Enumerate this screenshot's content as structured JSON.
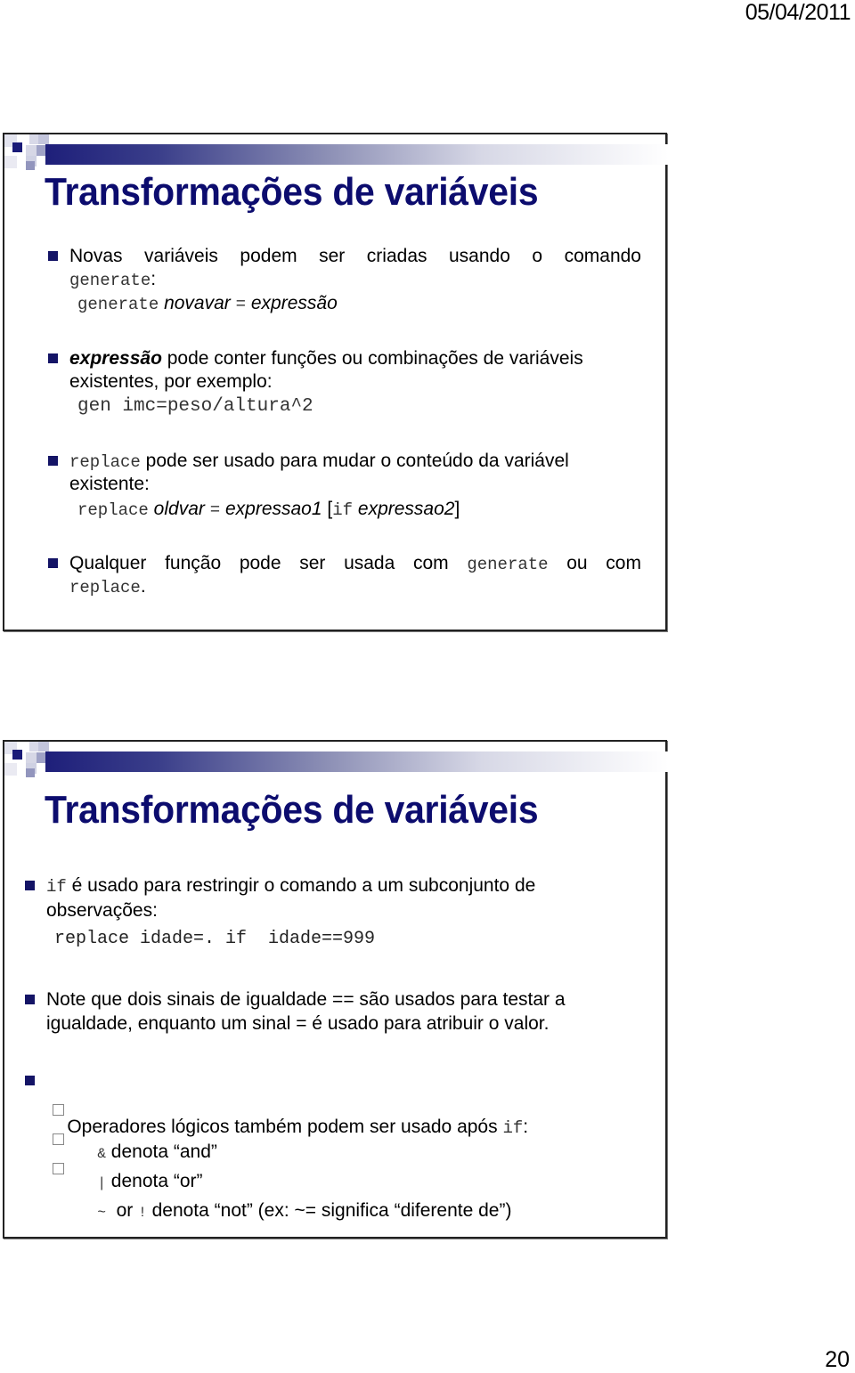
{
  "header": {
    "date": "05/04/2011"
  },
  "footer": {
    "page_number": "20"
  },
  "colors": {
    "title": "#0c0c6e",
    "bullet": "#141466",
    "code": "#333333"
  },
  "slides": [
    {
      "title": "Transformações de variáveis",
      "bullets": [
        {
          "icon": "square-bullet-icon",
          "text_line1": "Novas variáveis podem ser criadas usando o comando",
          "code_line2": "generate",
          "text_line2_suffix": ":",
          "code_example": {
            "cmd": "generate",
            "arg1": "novavar",
            "eq": "=",
            "arg2": "expressão"
          }
        },
        {
          "icon": "square-bullet-icon",
          "bold_italic": "expressão",
          "text_line1": " pode conter funções ou combinações de variáveis",
          "text_line2": "existentes, por exemplo:",
          "code_example": "gen imc=peso/altura^2"
        },
        {
          "icon": "square-bullet-icon",
          "code_prefix": "replace",
          "text_line1": " pode ser usado para mudar o conteúdo da variável",
          "text_line2": "existente:",
          "code_example": {
            "cmd": "replace",
            "arg1": "oldvar",
            "eq": "=",
            "arg2": "expressao1",
            "bracket_open": "[",
            "kw": "if",
            "arg3": "expressao2",
            "bracket_close": "]"
          }
        },
        {
          "icon": "square-bullet-icon",
          "text_line1": "Qualquer função pode ser usada com",
          "code_mid": "generate",
          "text_line1_suffix": "ou com",
          "code_line2": "replace",
          "text_line2_suffix": "."
        }
      ]
    },
    {
      "title": "Transformações de variáveis",
      "bullets": [
        {
          "icon": "square-bullet-icon",
          "code_prefix": "if",
          "text_line1": " é usado para restringir o comando a um subconjunto de",
          "text_line2": "observações:",
          "code_example": "replace idade=. if  idade==999"
        },
        {
          "icon": "square-bullet-icon",
          "text_line1": "Note que dois sinais de igualdade == são usados para testar a",
          "text_line2": "igualdade, enquanto um sinal = é usado para atribuir o valor."
        },
        {
          "icon": "square-bullet-icon",
          "text_line1": "Operadores lógicos também podem ser usado após ",
          "code_suffix": "if",
          "text_suffix": ":",
          "sub_items": [
            {
              "icon": "hollow-square-bullet-icon",
              "code": "&",
              "text": " denota “and”"
            },
            {
              "icon": "hollow-square-bullet-icon",
              "code": "|",
              "text": " denota “or”"
            },
            {
              "icon": "hollow-square-bullet-icon",
              "code": "~",
              "mid": "  or ",
              "code2": "!",
              "text": " denota “not” (ex: ~= significa “diferente de”)"
            }
          ]
        }
      ]
    }
  ]
}
